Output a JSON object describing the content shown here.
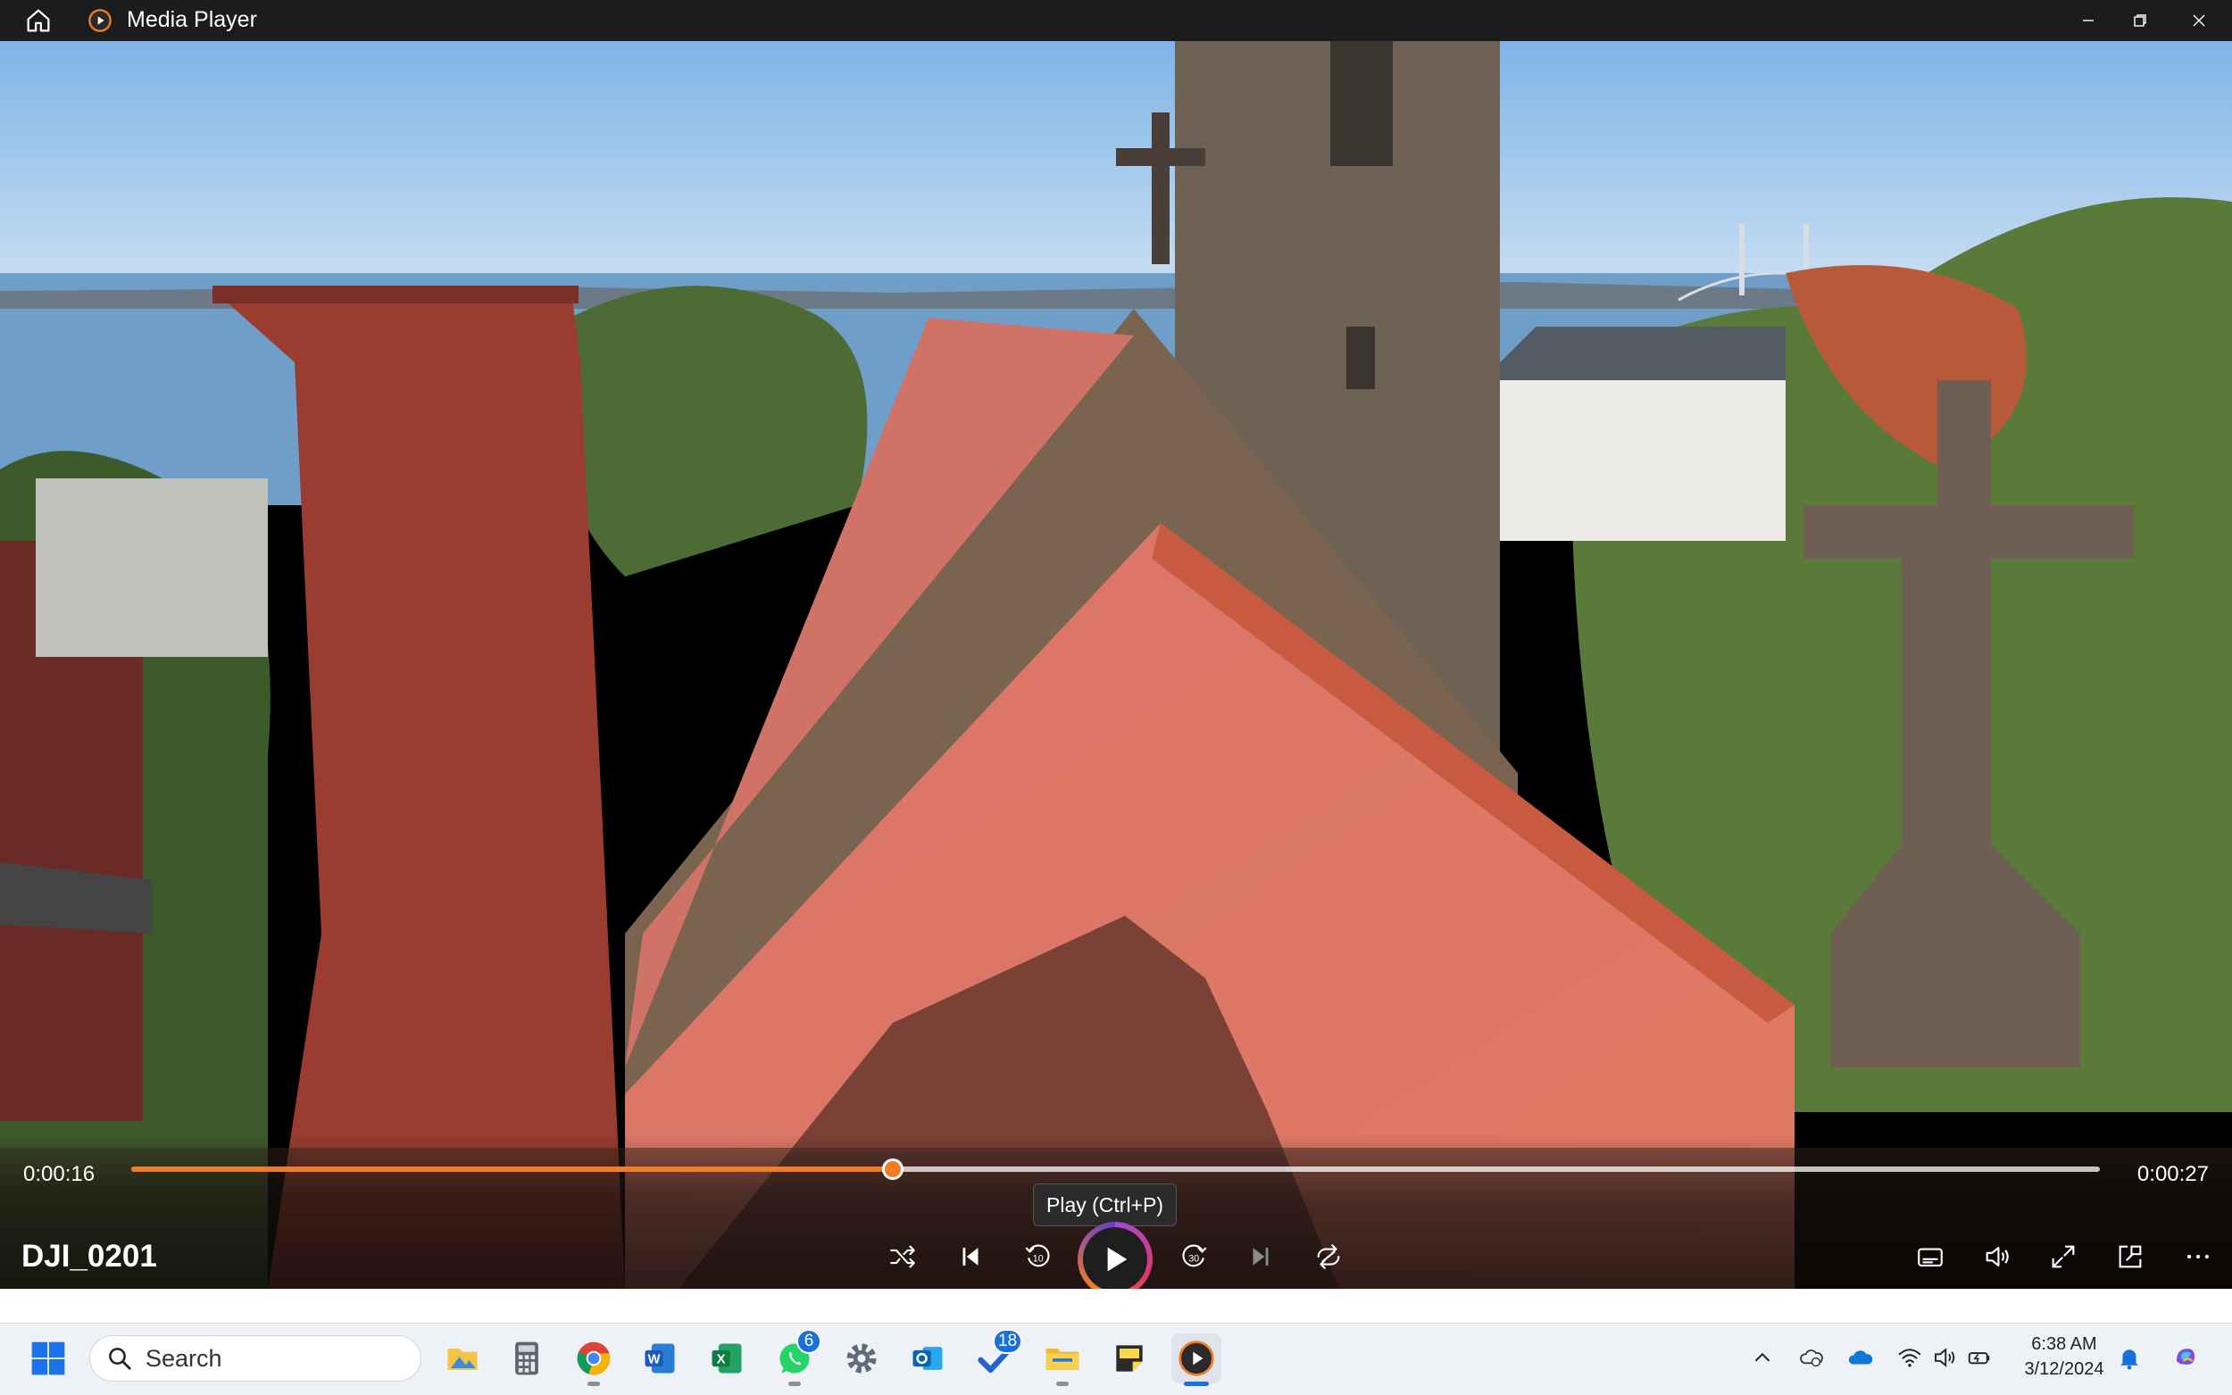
{
  "window": {
    "title": "Media Player"
  },
  "player": {
    "current_time": "0:00:16",
    "total_time": "0:00:27",
    "progress": 0.387,
    "media_title": "DJI_0201",
    "tooltip": "Play (Ctrl+P)"
  },
  "colors": {
    "accent": "#f07d24",
    "titlebar": "#1c1c1c",
    "taskbar": "#eef1f6"
  },
  "taskbar": {
    "search_placeholder": "Search",
    "apps": [
      {
        "name": "file-explorer-photos-icon"
      },
      {
        "name": "calculator-icon"
      },
      {
        "name": "chrome-icon"
      },
      {
        "name": "word-icon"
      },
      {
        "name": "excel-icon"
      },
      {
        "name": "whatsapp-icon",
        "badge": "6"
      },
      {
        "name": "settings-icon"
      },
      {
        "name": "outlook-icon"
      },
      {
        "name": "todo-icon",
        "badge": "18"
      },
      {
        "name": "file-explorer-icon"
      },
      {
        "name": "sticky-notes-icon"
      },
      {
        "name": "media-player-icon"
      }
    ],
    "clock_time": "6:38 AM",
    "clock_date": "3/12/2024"
  }
}
